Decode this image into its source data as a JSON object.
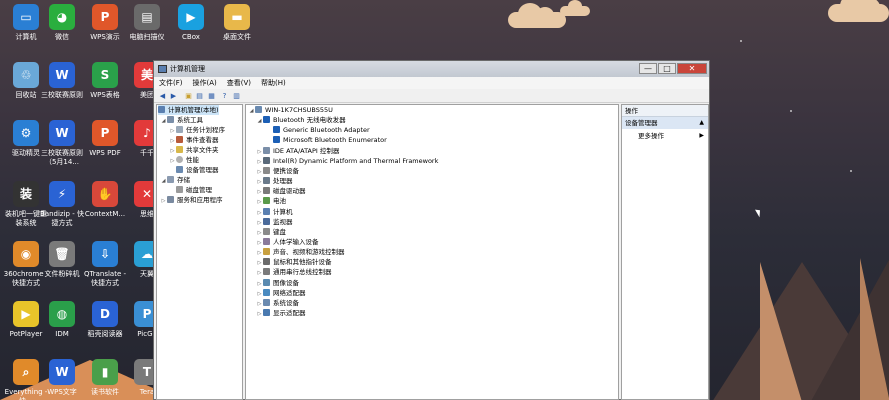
{
  "desktop": {
    "icons": [
      {
        "label": "计算机",
        "icon": "computer-icon",
        "color": "#2a7fd4",
        "glyph": "▭"
      },
      {
        "label": "微信",
        "icon": "wechat-icon",
        "color": "#2aae3e",
        "glyph": "◕"
      },
      {
        "label": "WPS演示",
        "icon": "wps-presentation-icon",
        "color": "#e0572a",
        "glyph": "P"
      },
      {
        "label": "电脑扫描仪",
        "icon": "scanner-icon",
        "color": "#6a6a6a",
        "glyph": "▤"
      },
      {
        "label": "CBox",
        "icon": "cbox-icon",
        "color": "#1aa1e0",
        "glyph": "▶"
      },
      {
        "label": "桌面文件",
        "icon": "folder-icon",
        "color": "#e8b84a",
        "glyph": "▬"
      },
      {
        "label": "回收站",
        "icon": "recycle-bin-icon",
        "color": "#6aa8d8",
        "glyph": "♲"
      },
      {
        "label": "三校联赛原则",
        "icon": "wps-doc-icon",
        "color": "#2a63d4",
        "glyph": "W"
      },
      {
        "label": "WPS表格",
        "icon": "wps-spreadsheet-icon",
        "color": "#2aa14a",
        "glyph": "S"
      },
      {
        "label": "美团",
        "icon": "meituan-icon",
        "color": "#e23a3a",
        "glyph": "美"
      },
      {
        "label": "驱动精灵",
        "icon": "driver-icon",
        "color": "#2a7fd4",
        "glyph": "⚙"
      },
      {
        "label": "三校联赛原则（5月14...",
        "icon": "wps-doc-icon",
        "color": "#2a63d4",
        "glyph": "W"
      },
      {
        "label": "WPS PDF",
        "icon": "wps-pdf-icon",
        "color": "#e0572a",
        "glyph": "P"
      },
      {
        "label": "千千",
        "icon": "music-icon",
        "color": "#e23a3a",
        "glyph": "♪"
      },
      {
        "label": "装机吧一键重装系统",
        "icon": "reinstall-icon",
        "color": "#333",
        "glyph": "装"
      },
      {
        "label": "Bandizip - 快捷方式",
        "icon": "bandizip-icon",
        "color": "#2a63d4",
        "glyph": "⚡"
      },
      {
        "label": "ContextM...",
        "icon": "contextmenu-icon",
        "color": "#d8483a",
        "glyph": "✋"
      },
      {
        "label": "思维",
        "icon": "mindmap-icon",
        "color": "#e23a3a",
        "glyph": "✕"
      },
      {
        "label": "360chrome - 快捷方式",
        "icon": "chrome-icon",
        "color": "#e08a2a",
        "glyph": "◉"
      },
      {
        "label": "文件粉碎机",
        "icon": "shredder-icon",
        "color": "#7a7a7a",
        "glyph": "🗑"
      },
      {
        "label": "QTranslate - 快捷方式",
        "icon": "qtranslate-icon",
        "color": "#2a7fd4",
        "glyph": "⇩"
      },
      {
        "label": "天翼",
        "icon": "tianyi-icon",
        "color": "#2a9fd4",
        "glyph": "☁"
      },
      {
        "label": "PotPlayer",
        "icon": "potplayer-icon",
        "color": "#e8c42a",
        "glyph": "▶"
      },
      {
        "label": "IDM",
        "icon": "idm-icon",
        "color": "#2a9f4a",
        "glyph": "◍"
      },
      {
        "label": "稻壳阅读器",
        "icon": "reader-icon",
        "color": "#2a63d4",
        "glyph": "D"
      },
      {
        "label": "PicGo",
        "icon": "picgo-icon",
        "color": "#3a8fd4",
        "glyph": "P"
      },
      {
        "label": "Everything - 快...",
        "icon": "everything-icon",
        "color": "#e08a2a",
        "glyph": "⌕"
      },
      {
        "label": "WPS文字",
        "icon": "wps-writer-icon",
        "color": "#2a63d4",
        "glyph": "W"
      },
      {
        "label": "读书软件",
        "icon": "book-icon",
        "color": "#4a9f4a",
        "glyph": "▮"
      },
      {
        "label": "Tera",
        "icon": "tera-icon",
        "color": "#7a7a7a",
        "glyph": "T"
      }
    ]
  },
  "window": {
    "title": "计算机管理",
    "menus": [
      "文件(F)",
      "操作(A)",
      "查看(V)",
      "帮助(H)"
    ],
    "minimize": "—",
    "maximize": "□",
    "close": "✕"
  },
  "tree": {
    "root": "计算机管理(本地)",
    "items": [
      "系统工具",
      "任务计划程序",
      "事件查看器",
      "共享文件夹",
      "性能",
      "设备管理器",
      "存储",
      "磁盘管理",
      "服务和应用程序"
    ]
  },
  "devices": {
    "computer": "WIN-1K7CHSUBS55U",
    "bluetooth": "Bluetooth 无线电收发器",
    "bt_children": [
      "Generic Bluetooth Adapter",
      "Microsoft Bluetooth Enumerator"
    ],
    "categories": [
      "IDE ATA/ATAPI 控制器",
      "Intel(R) Dynamic Platform and Thermal Framework",
      "便携设备",
      "处理器",
      "磁盘驱动器",
      "电池",
      "计算机",
      "监视器",
      "键盘",
      "人体学输入设备",
      "声音、视频和游戏控制器",
      "鼠标和其他指针设备",
      "通用串行总线控制器",
      "图像设备",
      "网络适配器",
      "系统设备",
      "显示适配器"
    ]
  },
  "actions": {
    "header": "操作",
    "selected": "设备管理器",
    "more": "更多操作"
  }
}
